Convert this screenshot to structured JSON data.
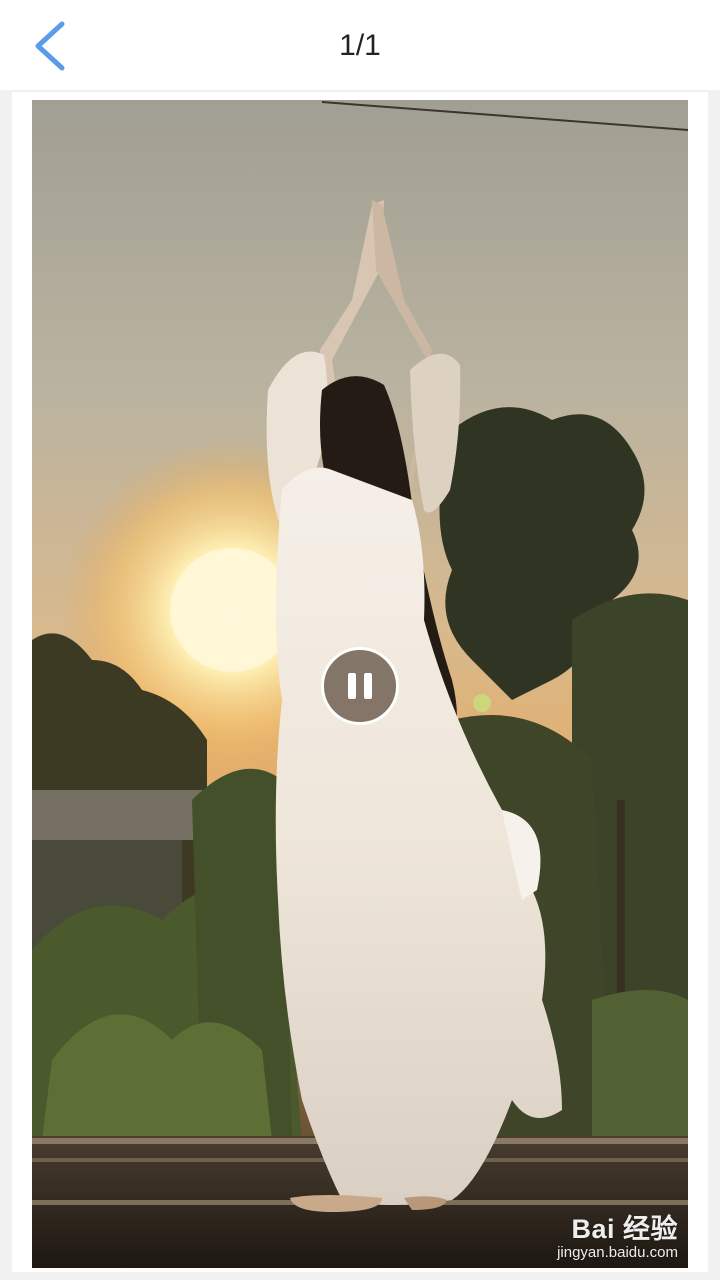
{
  "header": {
    "back_icon": "chevron-left-icon",
    "page_counter": "1/1",
    "accent_color": "#5a9bea"
  },
  "viewer": {
    "media_type": "video",
    "state": "playing",
    "control_icon": "pause-icon",
    "watermark_brand": "Bai 经验",
    "watermark_url": "jingyan.baidu.com"
  }
}
